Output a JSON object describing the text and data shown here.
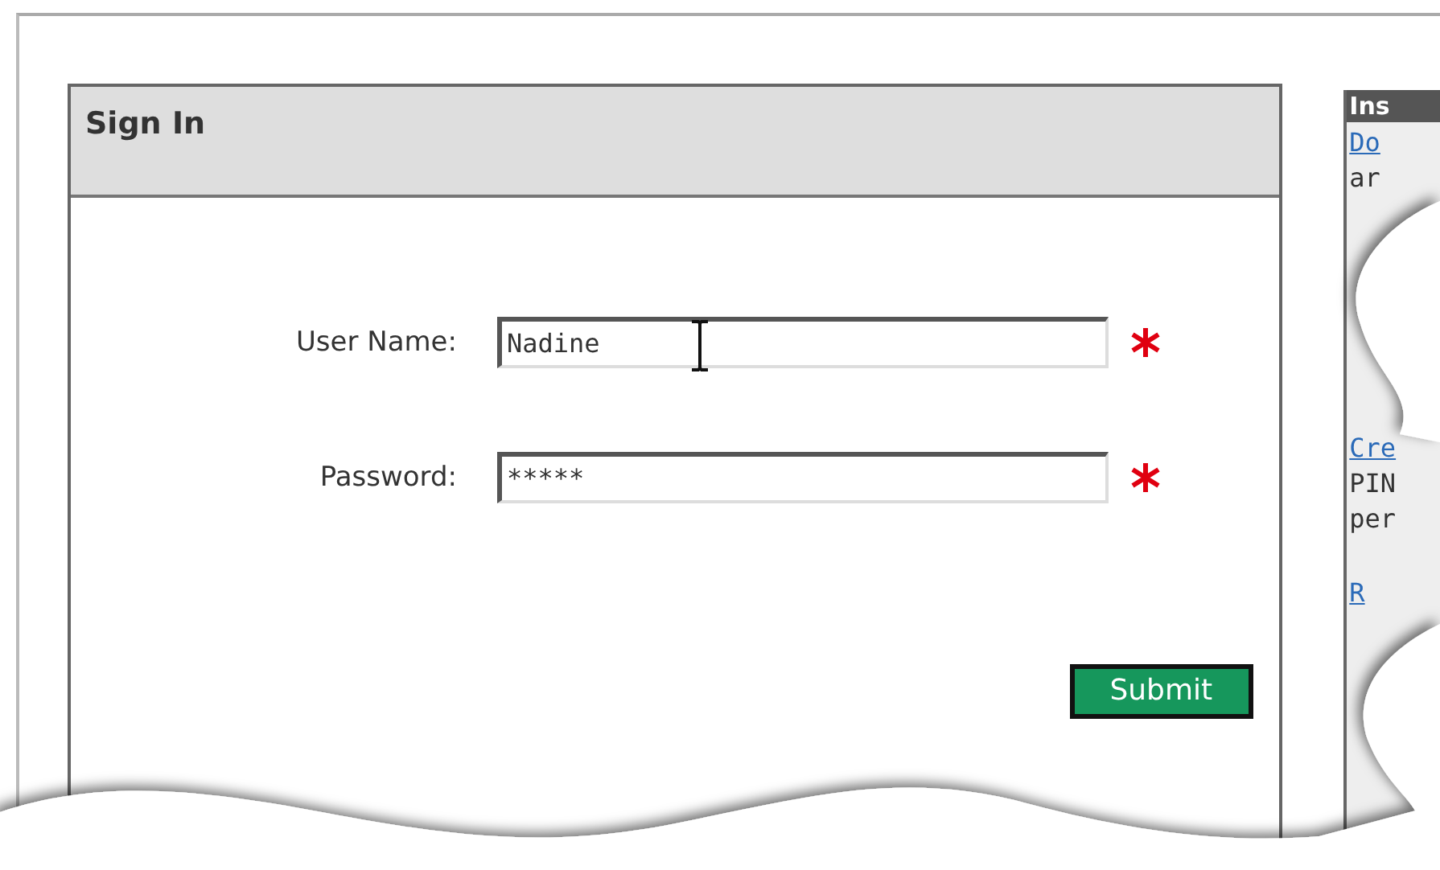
{
  "sign_in": {
    "title": "Sign In",
    "fields": [
      {
        "label": "User Name:",
        "value": "Nadine",
        "required": true,
        "cursor": true
      },
      {
        "label": "Password:",
        "value": "*****",
        "required": true,
        "cursor": false
      }
    ],
    "submit": "Submit"
  },
  "side_panel": {
    "title": "Ins",
    "items": [
      {
        "kind": "link",
        "text": "Do"
      },
      {
        "kind": "text",
        "text": "ar"
      },
      {
        "kind": "link",
        "text": "Cre"
      },
      {
        "kind": "text",
        "text": "PIN"
      },
      {
        "kind": "text",
        "text": "per"
      },
      {
        "kind": "link",
        "text": "R"
      }
    ]
  }
}
